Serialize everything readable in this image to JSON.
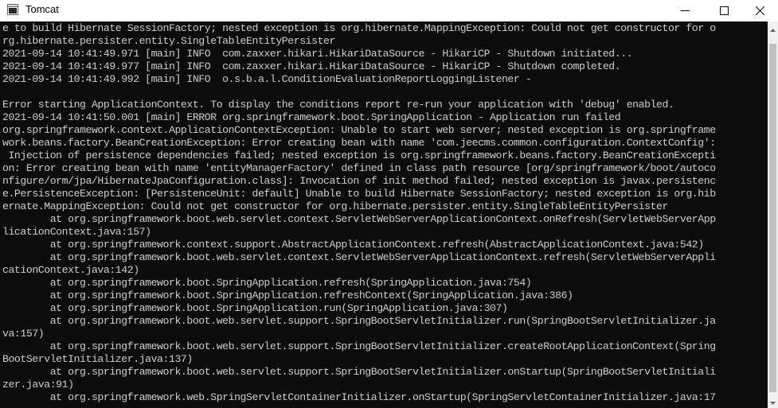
{
  "window": {
    "title": "Tomcat",
    "controls": {
      "minimize": "minimize",
      "maximize": "maximize",
      "close": "close"
    }
  },
  "console": {
    "background": "#0c0c0c",
    "text_color": "#cccccc",
    "lines": [
      "e to build Hibernate SessionFactory; nested exception is org.hibernate.MappingException: Could not get constructor for o",
      "rg.hibernate.persister.entity.SingleTableEntityPersister",
      "2021-09-14 10:41:49.971 [main] INFO  com.zaxxer.hikari.HikariDataSource - HikariCP - Shutdown initiated...",
      "2021-09-14 10:41:49.977 [main] INFO  com.zaxxer.hikari.HikariDataSource - HikariCP - Shutdown completed.",
      "2021-09-14 10:41:49.992 [main] INFO  o.s.b.a.l.ConditionEvaluationReportLoggingListener -",
      "",
      "Error starting ApplicationContext. To display the conditions report re-run your application with 'debug' enabled.",
      "2021-09-14 10:41:50.001 [main] ERROR org.springframework.boot.SpringApplication - Application run failed",
      "org.springframework.context.ApplicationContextException: Unable to start web server; nested exception is org.springframe",
      "work.beans.factory.BeanCreationException: Error creating bean with name 'com.jeecms.common.configuration.ContextConfig':",
      " Injection of persistence dependencies failed; nested exception is org.springframework.beans.factory.BeanCreationExcepti",
      "on: Error creating bean with name 'entityManagerFactory' defined in class path resource [org/springframework/boot/autoco",
      "nfigure/orm/jpa/HibernateJpaConfiguration.class]: Invocation of init method failed; nested exception is javax.persistenc",
      "e.PersistenceException: [PersistenceUnit: default] Unable to build Hibernate SessionFactory; nested exception is org.hib",
      "ernate.MappingException: Could not get constructor for org.hibernate.persister.entity.SingleTableEntityPersister",
      "        at org.springframework.boot.web.servlet.context.ServletWebServerApplicationContext.onRefresh(ServletWebServerApp",
      "licationContext.java:157)",
      "        at org.springframework.context.support.AbstractApplicationContext.refresh(AbstractApplicationContext.java:542)",
      "        at org.springframework.boot.web.servlet.context.ServletWebServerApplicationContext.refresh(ServletWebServerAppli",
      "cationContext.java:142)",
      "        at org.springframework.boot.SpringApplication.refresh(SpringApplication.java:754)",
      "        at org.springframework.boot.SpringApplication.refreshContext(SpringApplication.java:386)",
      "        at org.springframework.boot.SpringApplication.run(SpringApplication.java:307)",
      "        at org.springframework.boot.web.servlet.support.SpringBootServletInitializer.run(SpringBootServletInitializer.ja",
      "va:157)",
      "        at org.springframework.boot.web.servlet.support.SpringBootServletInitializer.createRootApplicationContext(Spring",
      "BootServletInitializer.java:137)",
      "        at org.springframework.boot.web.servlet.support.SpringBootServletInitializer.onStartup(SpringBootServletInitiali",
      "zer.java:91)",
      "        at org.springframework.web.SpringServletContainerInitializer.onStartup(SpringServletContainerInitializer.java:17"
    ]
  }
}
